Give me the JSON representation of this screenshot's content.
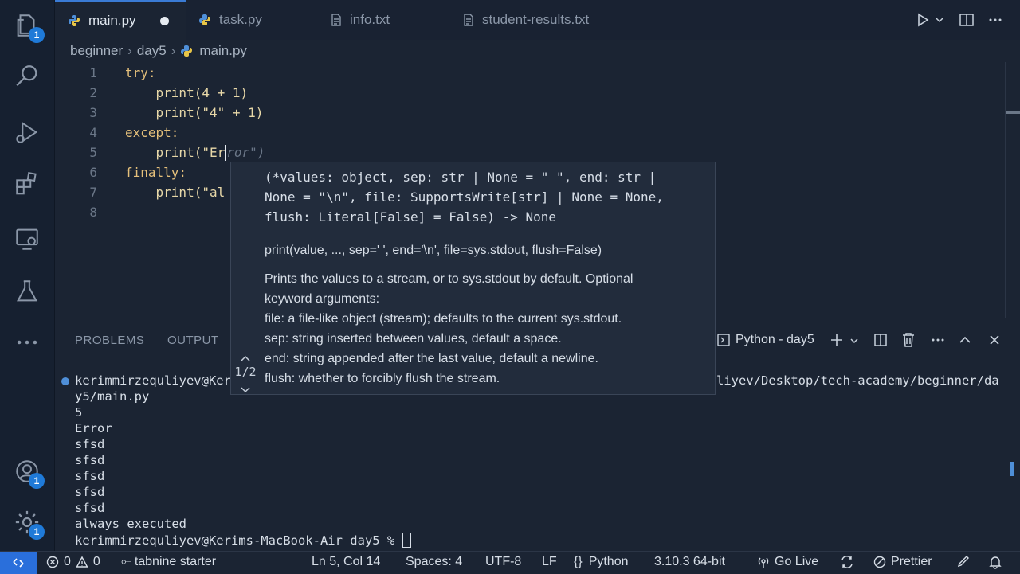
{
  "tabs": [
    {
      "label": "main.py",
      "modified": true,
      "active": true
    },
    {
      "label": "task.py",
      "active": false
    },
    {
      "label": "info.txt",
      "active": false
    },
    {
      "label": "student-results.txt",
      "active": false
    }
  ],
  "breadcrumb": [
    "beginner",
    "day5",
    "main.py"
  ],
  "activity_badges": {
    "explorer": "1",
    "accounts": "1",
    "manage": "1"
  },
  "editor": {
    "line_numbers": [
      "1",
      "2",
      "3",
      "4",
      "5",
      "6",
      "7",
      "8"
    ],
    "lines": [
      "try:",
      "    print(4 + 1)",
      "    print(\"4\" + 1)",
      "except:",
      "    print(\"Er",
      "finally:",
      "    print(\"al",
      ""
    ],
    "ghost_suggestion": "ror\")"
  },
  "hover": {
    "signature": [
      "(*values: object, sep: str | None = \" \", end: str |",
      "None = \"\\n\", file: SupportsWrite[str] | None = None,",
      "flush: Literal[False] = False) -> None"
    ],
    "call": "print(value, ..., sep=' ', end='\\n', file=sys.stdout, flush=False)",
    "doc": [
      "Prints the values to a stream, or to sys.stdout by default. Optional",
      "keyword arguments:",
      "file: a file-like object (stream); defaults to the current sys.stdout.",
      "sep: string inserted between values, default a space.",
      "end: string appended after the last value, default a newline.",
      "flush: whether to forcibly flush the stream."
    ],
    "pager": "1/2"
  },
  "panel": {
    "tabs": [
      "PROBLEMS",
      "OUTPUT"
    ],
    "terminal_name": "Python - day5",
    "terminal_lines": [
      "kerimmirzequliyev@Ker",
      "y5/main.py",
      "5",
      "Error",
      "sfsd",
      "sfsd",
      "sfsd",
      "sfsd",
      "sfsd",
      "always executed",
      "kerimmirzequliyev@Kerims-MacBook-Air day5 % "
    ],
    "terminal_line1_right": "liyev/Desktop/tech-academy/beginner/da"
  },
  "status": {
    "errors": "0",
    "warnings": "0",
    "tabnine": "tabnine starter",
    "position": "Ln 5, Col 14",
    "spaces": "Spaces: 4",
    "encoding": "UTF-8",
    "eol": "LF",
    "language": "Python",
    "interpreter": "3.10.3 64-bit",
    "golive": "Go Live",
    "prettier": "Prettier"
  },
  "colors": {
    "accent": "#1f7ad8",
    "remote": "#2a6fdb",
    "background": "#1b2433"
  }
}
